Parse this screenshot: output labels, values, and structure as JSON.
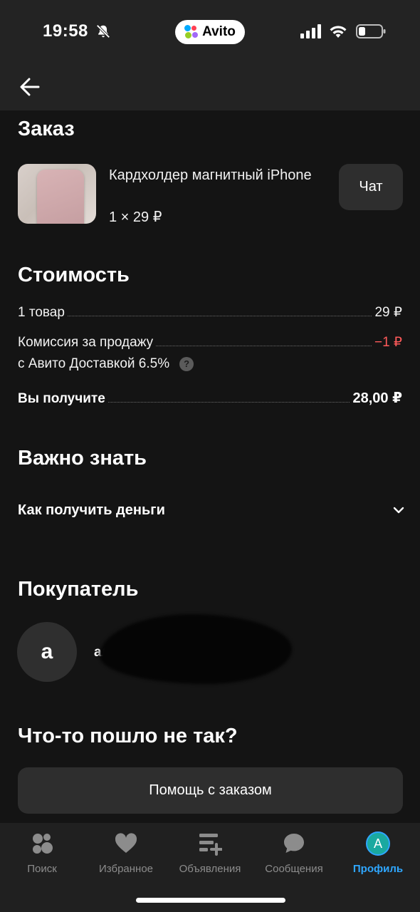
{
  "status_bar": {
    "time": "19:58",
    "app_pill": "Avito"
  },
  "colors": {
    "background": "#141414",
    "header": "#232323",
    "negative": "#ff5a5a",
    "accent": "#2fa7ff",
    "card": "#2e2e2e"
  },
  "order": {
    "heading": "Заказ",
    "title": "Кардхолдер магнитный iPhone",
    "qty_price": "1 × 29 ₽",
    "chat_label": "Чат"
  },
  "cost": {
    "heading": "Стоимость",
    "rows": [
      {
        "label": "1 товар",
        "value": "29 ₽"
      },
      {
        "label": "Комиссия за продажу",
        "label2": "с Авито Доставкой 6.5%",
        "value": "−1 ₽"
      },
      {
        "label": "Вы получите",
        "value": "28,00 ₽"
      }
    ],
    "help_glyph": "?"
  },
  "important": {
    "heading": "Важно знать",
    "accordion_label": "Как получить деньги"
  },
  "buyer": {
    "heading": "Покупатель",
    "avatar_letter": "а",
    "name_visible": "ал"
  },
  "problem": {
    "heading": "Что-то пошло не так?",
    "help_button": "Помощь с заказом"
  },
  "tabbar": {
    "items": [
      {
        "label": "Поиск",
        "icon": "search-bubbles-icon",
        "active": false
      },
      {
        "label": "Избранное",
        "icon": "heart-icon",
        "active": false
      },
      {
        "label": "Объявления",
        "icon": "listings-add-icon",
        "active": false
      },
      {
        "label": "Сообщения",
        "icon": "chat-bubble-icon",
        "active": false
      },
      {
        "label": "Профиль",
        "icon": "profile-avatar-icon",
        "active": true,
        "avatar_letter": "A"
      }
    ]
  }
}
